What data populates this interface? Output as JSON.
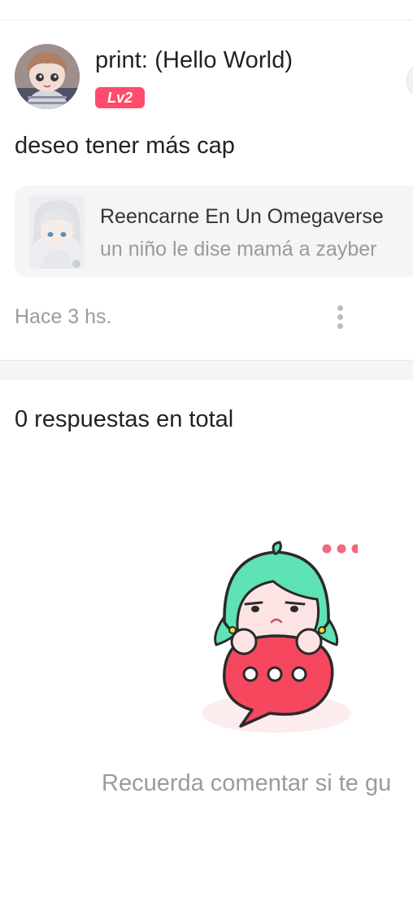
{
  "post": {
    "author_name": "print: (Hello World)",
    "level_badge": "Lv2",
    "text": "deseo tener más cap",
    "timestamp": "Hace 3 hs."
  },
  "story_card": {
    "title": "Reencarne En Un Omegaverse",
    "subtitle": "un niño le dise mamá a zayber"
  },
  "replies": {
    "count_label": "0 respuestas en total",
    "empty_hint": "Recuerda comentar si te gu"
  },
  "colors": {
    "badge": "#ff4c6a",
    "mascot_hair": "#5fe2b4",
    "mascot_bubble": "#f5485e",
    "text_primary": "#222222",
    "text_secondary": "#9b9b9b"
  },
  "icons": {
    "more": "more-vertical-icon",
    "mascot": "comment-mascot-illustration"
  }
}
